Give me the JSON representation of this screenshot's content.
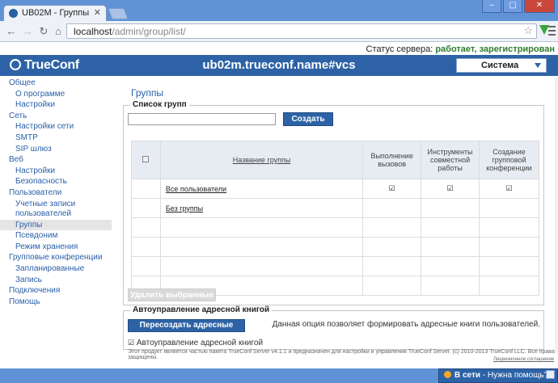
{
  "browser": {
    "tab_title": "UB02M - Группы",
    "tab_close": "✕",
    "win_min": "–",
    "win_max": "▢",
    "win_close": "✕",
    "url_host": "localhost",
    "url_path": "/admin/group/list/"
  },
  "status": {
    "label": "Статус сервера:",
    "working": "работает",
    "registered": "зарегистрирован"
  },
  "header": {
    "logo": "TrueConf",
    "title": "ub02m.trueconf.name#vcs",
    "select_value": "Система"
  },
  "sidebar": {
    "items": [
      {
        "label": "Общее",
        "level": 0
      },
      {
        "label": "О программе",
        "level": 1
      },
      {
        "label": "Настройки",
        "level": 1
      },
      {
        "label": "Сеть",
        "level": 0
      },
      {
        "label": "Настройки сети",
        "level": 1
      },
      {
        "label": "SMTP",
        "level": 1
      },
      {
        "label": "SIP шлюз",
        "level": 1
      },
      {
        "label": "Веб",
        "level": 0
      },
      {
        "label": "Настройки",
        "level": 1
      },
      {
        "label": "Безопасность",
        "level": 1
      },
      {
        "label": "Пользователи",
        "level": 0
      },
      {
        "label": "Учетные записи пользователей",
        "level": 1
      },
      {
        "label": "Группы",
        "level": 1,
        "active": true
      },
      {
        "label": "Псевдоним",
        "level": 1
      },
      {
        "label": "Режим хранения",
        "level": 1
      },
      {
        "label": "Групповые конференции",
        "level": 0
      },
      {
        "label": "Запланированные",
        "level": 1
      },
      {
        "label": "Запись",
        "level": 1
      },
      {
        "label": "Подключения",
        "level": 0
      },
      {
        "label": "Помощь",
        "level": 0
      }
    ]
  },
  "main": {
    "page_title": "Группы",
    "groups_legend": "Список групп",
    "search_value": "",
    "create_button": "Создать",
    "table": {
      "headers": [
        "Название группы",
        "Выполнение вызовов",
        "Инструменты совместной работы",
        "Создание групповой конференции"
      ],
      "rows": [
        {
          "name": "Все пользователи",
          "calls": true,
          "tools": true,
          "conf": true
        },
        {
          "name": "Без группы",
          "calls": false,
          "tools": false,
          "conf": false
        }
      ]
    },
    "delete_button": "Удалить выбранные",
    "addr_legend": "Автоуправление адресной книгой",
    "recreate_button": "Пересоздать адресные книги",
    "addr_desc": "Данная опция позволяет формировать адресные книги пользователей.",
    "auto_label": "Автоуправление адресной книгой",
    "auto_checked": true
  },
  "footer": {
    "text": "Этот продукт является частью пакета TrueConf Server v4.1.1 и предназначен для настройки и управления TrueConf Server. (c) 2010-2013 TrueConf LLC. Все права защищены.",
    "license": "Лицензионное соглашение"
  },
  "chat": {
    "text_bold": "В сети",
    "text_rest": " - Нужна помощь?"
  }
}
